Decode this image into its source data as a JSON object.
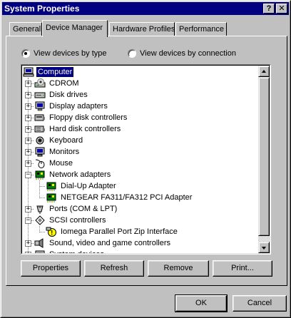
{
  "window": {
    "title": "System Properties",
    "help_glyph": "?",
    "close_glyph": "✕"
  },
  "tabs": [
    {
      "label": "General"
    },
    {
      "label": "Device Manager"
    },
    {
      "label": "Hardware Profiles"
    },
    {
      "label": "Performance"
    }
  ],
  "view_options": {
    "by_type": {
      "label": "View devices by type",
      "selected": true
    },
    "by_connection": {
      "label": "View devices by connection",
      "selected": false
    }
  },
  "tree": [
    {
      "label": "Computer",
      "icon": "computer-icon",
      "selected": true
    },
    {
      "label": "CDROM",
      "icon": "cdrom-icon",
      "expander": "+"
    },
    {
      "label": "Disk drives",
      "icon": "disk-drive-icon",
      "expander": "+"
    },
    {
      "label": "Display adapters",
      "icon": "display-adapter-icon",
      "expander": "+"
    },
    {
      "label": "Floppy disk controllers",
      "icon": "floppy-controller-icon",
      "expander": "+"
    },
    {
      "label": "Hard disk controllers",
      "icon": "hard-disk-controller-icon",
      "expander": "+"
    },
    {
      "label": "Keyboard",
      "icon": "keyboard-icon",
      "expander": "+"
    },
    {
      "label": "Monitors",
      "icon": "monitor-icon",
      "expander": "+"
    },
    {
      "label": "Mouse",
      "icon": "mouse-icon",
      "expander": "+"
    },
    {
      "label": "Network adapters",
      "icon": "network-adapter-icon",
      "expander": "−"
    },
    {
      "label": "Dial-Up Adapter",
      "icon": "network-card-icon",
      "child": true
    },
    {
      "label": "NETGEAR FA311/FA312 PCI Adapter",
      "icon": "network-card-icon",
      "child": true
    },
    {
      "label": "Ports (COM & LPT)",
      "icon": "port-icon",
      "expander": "+"
    },
    {
      "label": "SCSI controllers",
      "icon": "scsi-controller-icon",
      "expander": "−"
    },
    {
      "label": "Iomega Parallel Port Zip Interface",
      "icon": "warning-icon",
      "child": true
    },
    {
      "label": "Sound, video and game controllers",
      "icon": "sound-icon",
      "expander": "+"
    },
    {
      "label": "System devices",
      "icon": "system-device-icon",
      "expander": "+"
    }
  ],
  "buttons": {
    "properties": "Properties",
    "refresh": "Refresh",
    "remove": "Remove",
    "print": "Print...",
    "ok": "OK",
    "cancel": "Cancel"
  },
  "colors": {
    "selection": "#000080",
    "face": "#c0c0c0",
    "title_bar": "#000080"
  }
}
